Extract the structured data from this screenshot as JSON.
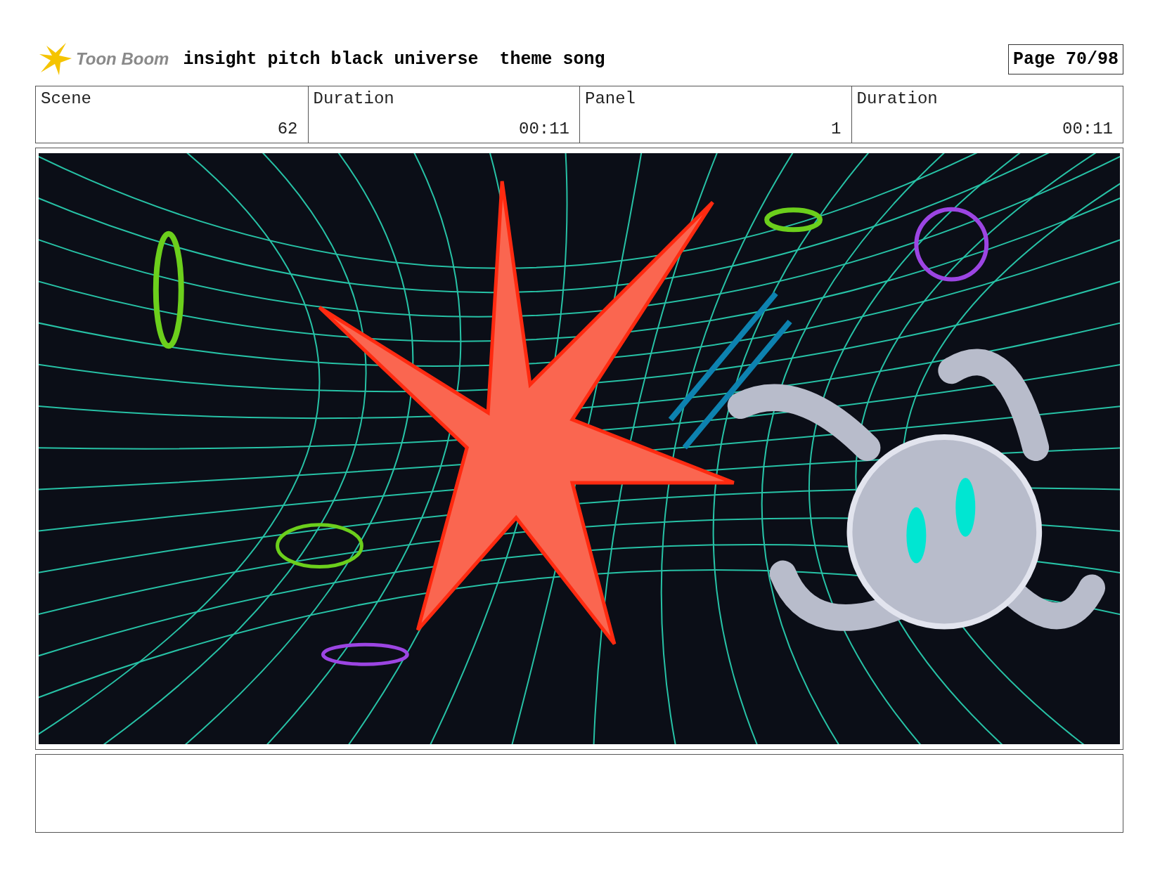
{
  "header": {
    "logo_text": "Toon Boom",
    "title": "insight pitch black universe  theme song",
    "page": "Page 70/98"
  },
  "fields": [
    {
      "label": "Scene",
      "value": "62"
    },
    {
      "label": "Duration",
      "value": "00:11"
    },
    {
      "label": "Panel",
      "value": "1"
    },
    {
      "label": "Duration",
      "value": "00:11"
    }
  ]
}
